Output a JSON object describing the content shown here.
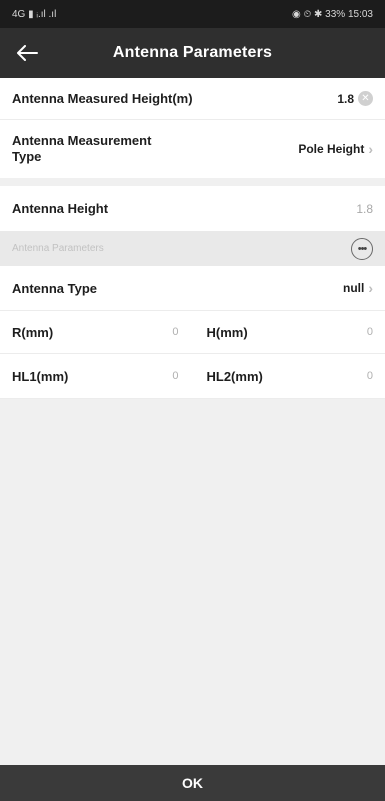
{
  "status": {
    "left": "4G ▮ ᵢ.ıl .ıl",
    "right": "◉ ⏲ ✱ 33% 15:03"
  },
  "header": {
    "title": "Antenna Parameters"
  },
  "rows": {
    "measured_height": {
      "label": "Antenna Measured Height(m)",
      "value": "1.8"
    },
    "measurement_type": {
      "label": "Antenna Measurement Type",
      "value": "Pole Height"
    },
    "antenna_height": {
      "label": "Antenna Height",
      "value": "1.8"
    },
    "section_label": "Antenna Parameters",
    "antenna_type": {
      "label": "Antenna Type",
      "value": "null"
    },
    "r": {
      "label": "R(mm)",
      "value": "0"
    },
    "h": {
      "label": "H(mm)",
      "value": "0"
    },
    "hl1": {
      "label": "HL1(mm)",
      "value": "0"
    },
    "hl2": {
      "label": "HL2(mm)",
      "value": "0"
    }
  },
  "footer": {
    "ok_label": "OK"
  },
  "colors": {
    "header_bg": "#2f2f2f",
    "footer_bg": "#3a3a3a",
    "page_bg": "#f0f0f0"
  }
}
